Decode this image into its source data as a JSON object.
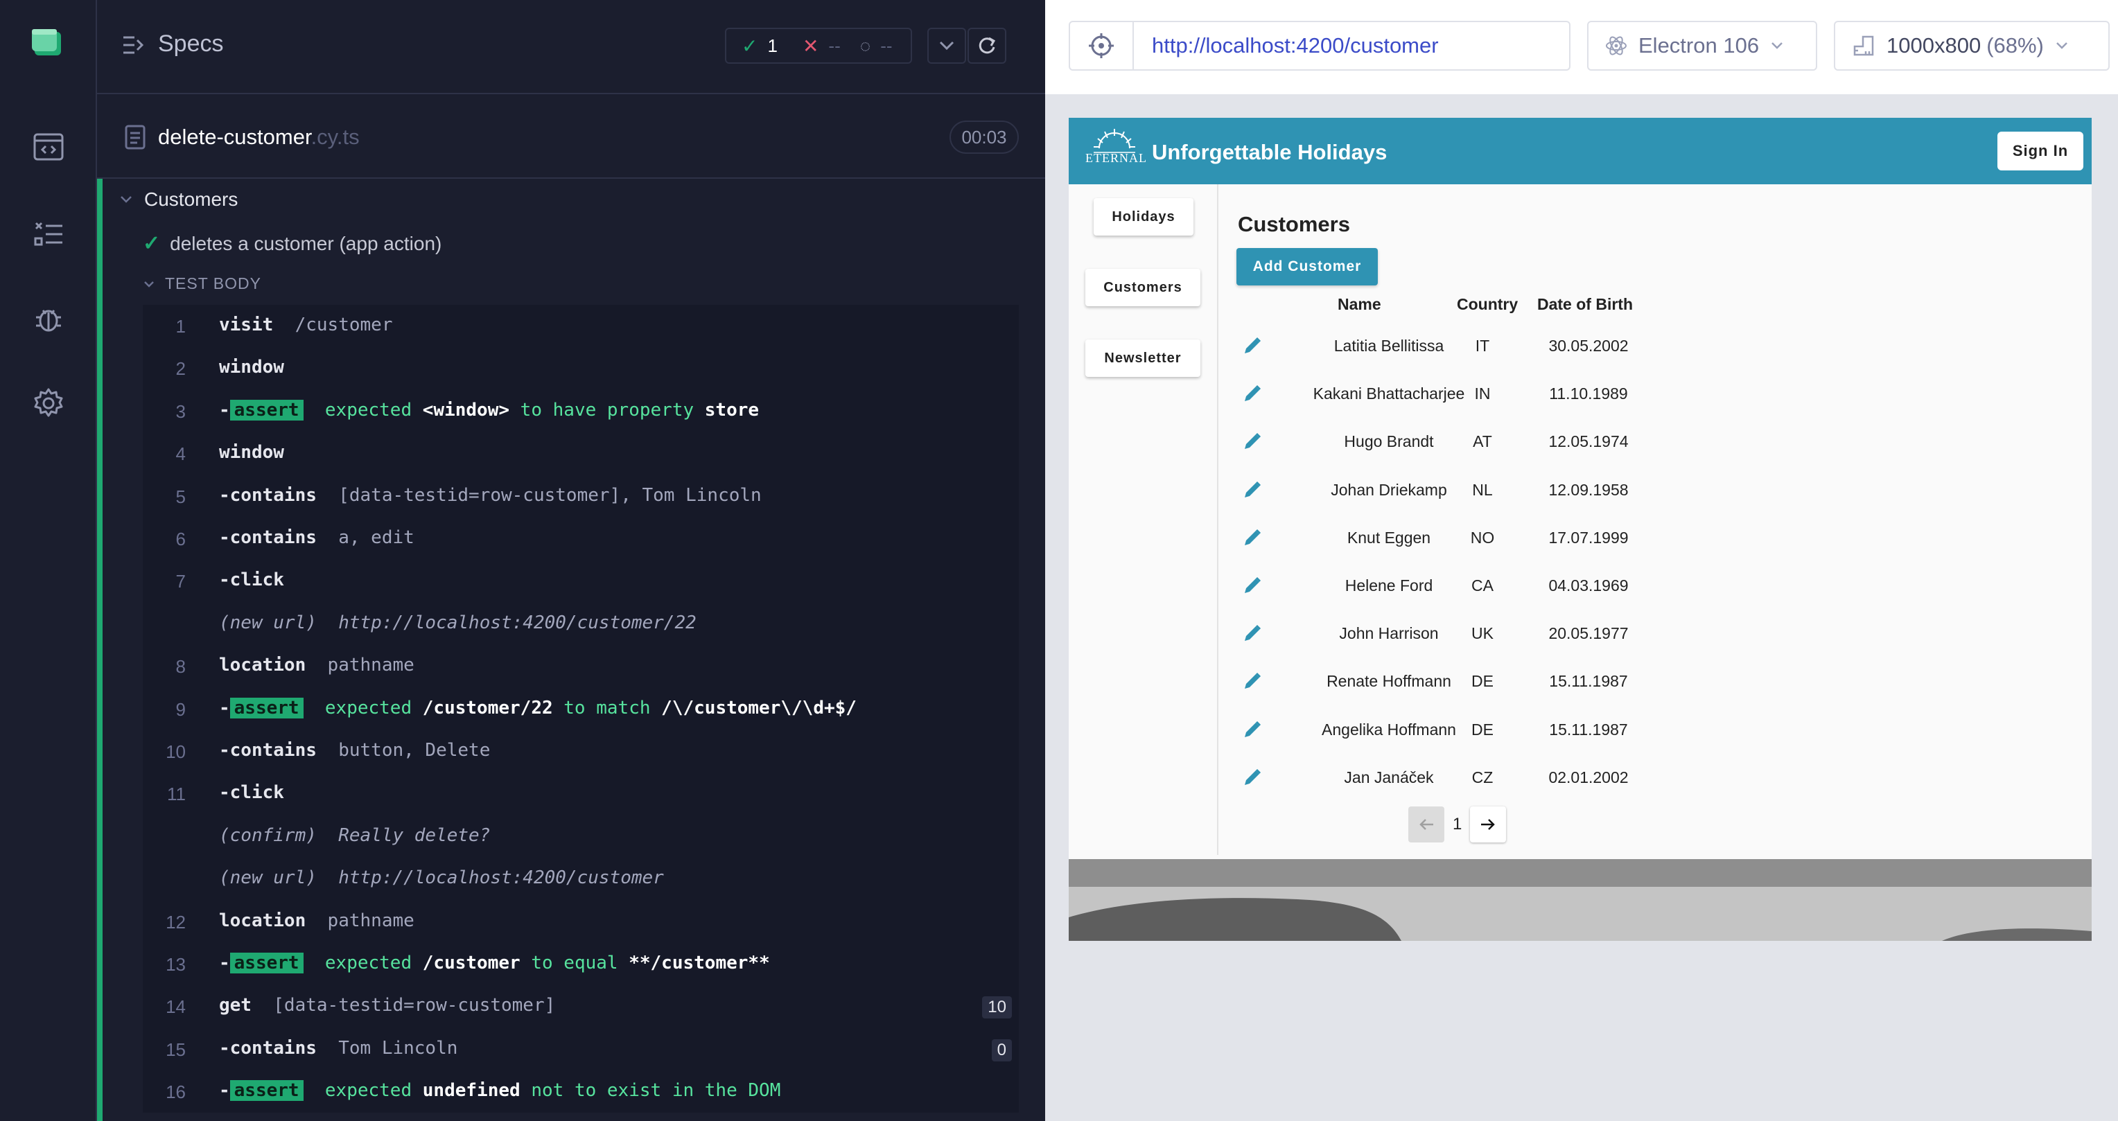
{
  "reporter": {
    "specs_label": "Specs",
    "passed": "1",
    "failed": "--",
    "pending": "--",
    "file_name": "delete-customer",
    "file_ext": ".cy.ts",
    "duration": "00:03",
    "suite_title": "Customers",
    "test_title": "deletes a customer (app action)",
    "test_body_label": "TEST BODY",
    "colors": {
      "pass": "#1fa971",
      "fail": "#e45770",
      "bg": "#1b1e2e"
    }
  },
  "commands": [
    {
      "num": "1",
      "name": "visit",
      "prefix": "",
      "message": "/customer"
    },
    {
      "num": "2",
      "name": "window",
      "prefix": "",
      "message": ""
    },
    {
      "num": "3",
      "name": "assert",
      "prefix": "-",
      "assert": true,
      "parts": [
        "expected",
        "<window>",
        "to have property",
        "store"
      ]
    },
    {
      "num": "4",
      "name": "window",
      "prefix": "",
      "message": ""
    },
    {
      "num": "5",
      "name": "contains",
      "prefix": "-",
      "message": "[data-testid=row-customer], Tom Lincoln"
    },
    {
      "num": "6",
      "name": "contains",
      "prefix": "-",
      "message": "a, edit"
    },
    {
      "num": "7",
      "name": "click",
      "prefix": "-",
      "message": ""
    },
    {
      "num": "",
      "event": true,
      "label": "(new url)",
      "message": "http://localhost:4200/customer/22"
    },
    {
      "num": "8",
      "name": "location",
      "prefix": "",
      "message": "pathname"
    },
    {
      "num": "9",
      "name": "assert",
      "prefix": "-",
      "assert": true,
      "parts": [
        "expected",
        "/customer/22",
        "to match",
        "/\\/customer\\/\\d+$/"
      ]
    },
    {
      "num": "10",
      "name": "contains",
      "prefix": "-",
      "message": "button, Delete"
    },
    {
      "num": "11",
      "name": "click",
      "prefix": "-",
      "message": ""
    },
    {
      "num": "",
      "event": true,
      "label": "(confirm)",
      "message": "Really delete?"
    },
    {
      "num": "",
      "event": true,
      "label": "(new url)",
      "message": "http://localhost:4200/customer"
    },
    {
      "num": "12",
      "name": "location",
      "prefix": "",
      "message": "pathname"
    },
    {
      "num": "13",
      "name": "assert",
      "prefix": "-",
      "assert": true,
      "parts": [
        "expected",
        "/customer",
        "to equal",
        "**/customer**"
      ]
    },
    {
      "num": "14",
      "name": "get",
      "prefix": "",
      "message": "[data-testid=row-customer]",
      "count": "10"
    },
    {
      "num": "15",
      "name": "contains",
      "prefix": "-",
      "message": "Tom Lincoln",
      "count": "0"
    },
    {
      "num": "16",
      "name": "assert",
      "prefix": "-",
      "assert": true,
      "parts": [
        "expected",
        "undefined",
        "not to exist in the DOM",
        ""
      ]
    }
  ],
  "browser_bar": {
    "url": "http://localhost:4200/customer",
    "browser": "Electron 106",
    "viewport": "1000x800",
    "scale": "(68%)"
  },
  "app": {
    "brand": "Unforgettable Holidays",
    "logo_text": "ETERNAL",
    "sign_in": "Sign In",
    "nav": [
      "Holidays",
      "Customers",
      "Newsletter"
    ],
    "title": "Customers",
    "add_button": "Add Customer",
    "columns": [
      "Name",
      "Country",
      "Date of Birth"
    ],
    "rows": [
      {
        "name": "Latitia Bellitissa",
        "country": "IT",
        "dob": "30.05.2002"
      },
      {
        "name": "Kakani Bhattacharjee",
        "country": "IN",
        "dob": "11.10.1989"
      },
      {
        "name": "Hugo Brandt",
        "country": "AT",
        "dob": "12.05.1974"
      },
      {
        "name": "Johan Driekamp",
        "country": "NL",
        "dob": "12.09.1958"
      },
      {
        "name": "Knut Eggen",
        "country": "NO",
        "dob": "17.07.1999"
      },
      {
        "name": "Helene Ford",
        "country": "CA",
        "dob": "04.03.1969"
      },
      {
        "name": "John Harrison",
        "country": "UK",
        "dob": "20.05.1977"
      },
      {
        "name": "Renate Hoffmann",
        "country": "DE",
        "dob": "15.11.1987"
      },
      {
        "name": "Angelika Hoffmann",
        "country": "DE",
        "dob": "15.11.1987"
      },
      {
        "name": "Jan Janáček",
        "country": "CZ",
        "dob": "02.01.2002"
      }
    ],
    "page": "1",
    "colors": {
      "toolbar": "#2f93b3",
      "pen": "#2f93b3"
    }
  }
}
